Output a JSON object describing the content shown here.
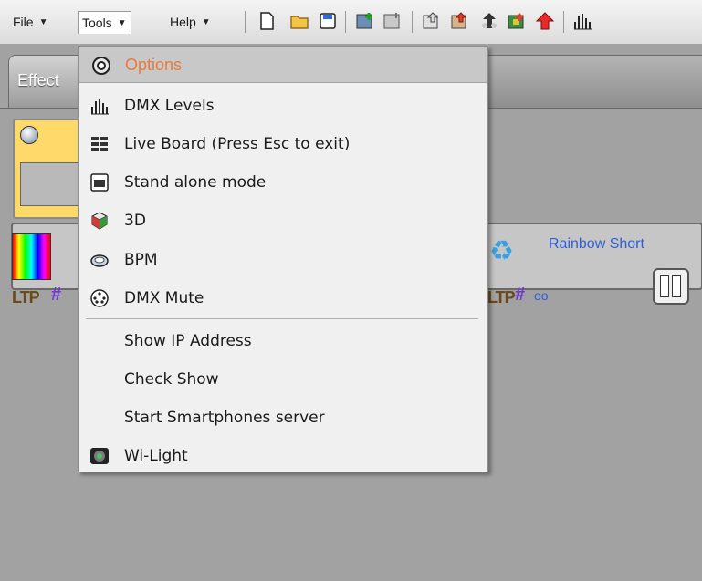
{
  "menubar": {
    "file": "File",
    "tools": "Tools",
    "help": "Help"
  },
  "toolbar": {
    "icons": [
      "new-document-icon",
      "open-folder-icon",
      "save-icon",
      "add-scene-icon",
      "scene-icon",
      "import-icon",
      "export-icon",
      "upload-icon",
      "color-scene-icon",
      "red-arrow-up-icon",
      "dmx-levels-icon"
    ]
  },
  "tabs": {
    "effects": "Effect"
  },
  "effect": {
    "ltp": "LTP",
    "hash": "#",
    "title": "Rainbow Short",
    "counter": "oo"
  },
  "tools_menu": {
    "options": "Options",
    "items": [
      {
        "label": "DMX Levels",
        "icon": "dmx-levels-icon"
      },
      {
        "label": "Live Board (Press Esc to exit)",
        "icon": "live-board-icon"
      },
      {
        "label": "Stand alone mode",
        "icon": "stand-alone-icon"
      },
      {
        "label": "3D",
        "icon": "3d-cube-icon"
      },
      {
        "label": "BPM",
        "icon": "bpm-icon"
      },
      {
        "label": "DMX Mute",
        "icon": "dmx-mute-icon"
      },
      {
        "label": "Show IP Address",
        "icon": ""
      },
      {
        "label": "Check Show",
        "icon": ""
      },
      {
        "label": "Start Smartphones server",
        "icon": ""
      },
      {
        "label": "Wi-Light",
        "icon": "wi-light-icon"
      }
    ]
  },
  "colors": {
    "options_text": "#e87b3e",
    "link_blue": "#2f5ed8",
    "highlight_yellow": "#ffd96a"
  }
}
